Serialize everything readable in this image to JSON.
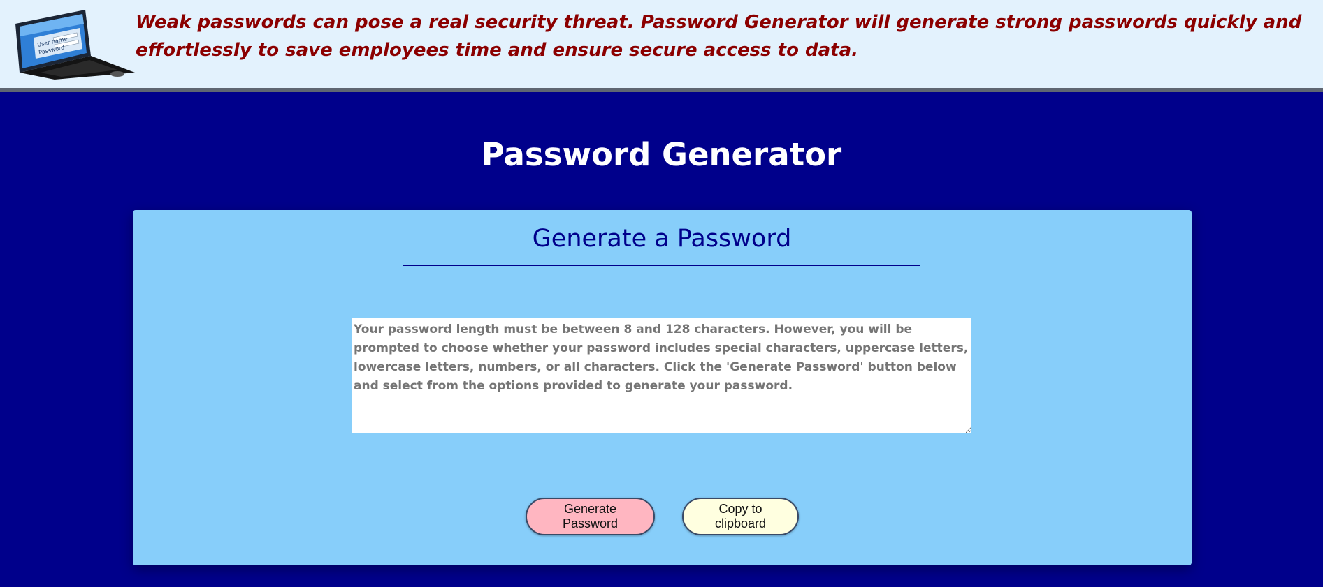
{
  "banner": {
    "message": "Weak passwords can pose a real security threat. Password Generator will generate strong passwords quickly and effortlessly to save employees time and ensure secure access to data.",
    "image_icon": "laptop-login-icon"
  },
  "header": {
    "title": "Password Generator"
  },
  "card": {
    "title": "Generate a Password",
    "password_field": {
      "value": "",
      "placeholder": "Your password length must be between 8 and 128 characters. However, you will be prompted to choose whether your password includes special characters, uppercase letters, lowercase letters, numbers, or all characters. Click the 'Generate Password' button below and select from the options provided to generate your password."
    },
    "buttons": {
      "generate_label": "Generate Password",
      "copy_label": "Copy to clipboard"
    }
  },
  "colors": {
    "page_background": "#00008b",
    "banner_background": "#e3f2fd",
    "banner_text": "#8b0000",
    "card_background": "#87cefa",
    "generate_button": "#ffb6c1",
    "copy_button": "#ffffe0"
  }
}
